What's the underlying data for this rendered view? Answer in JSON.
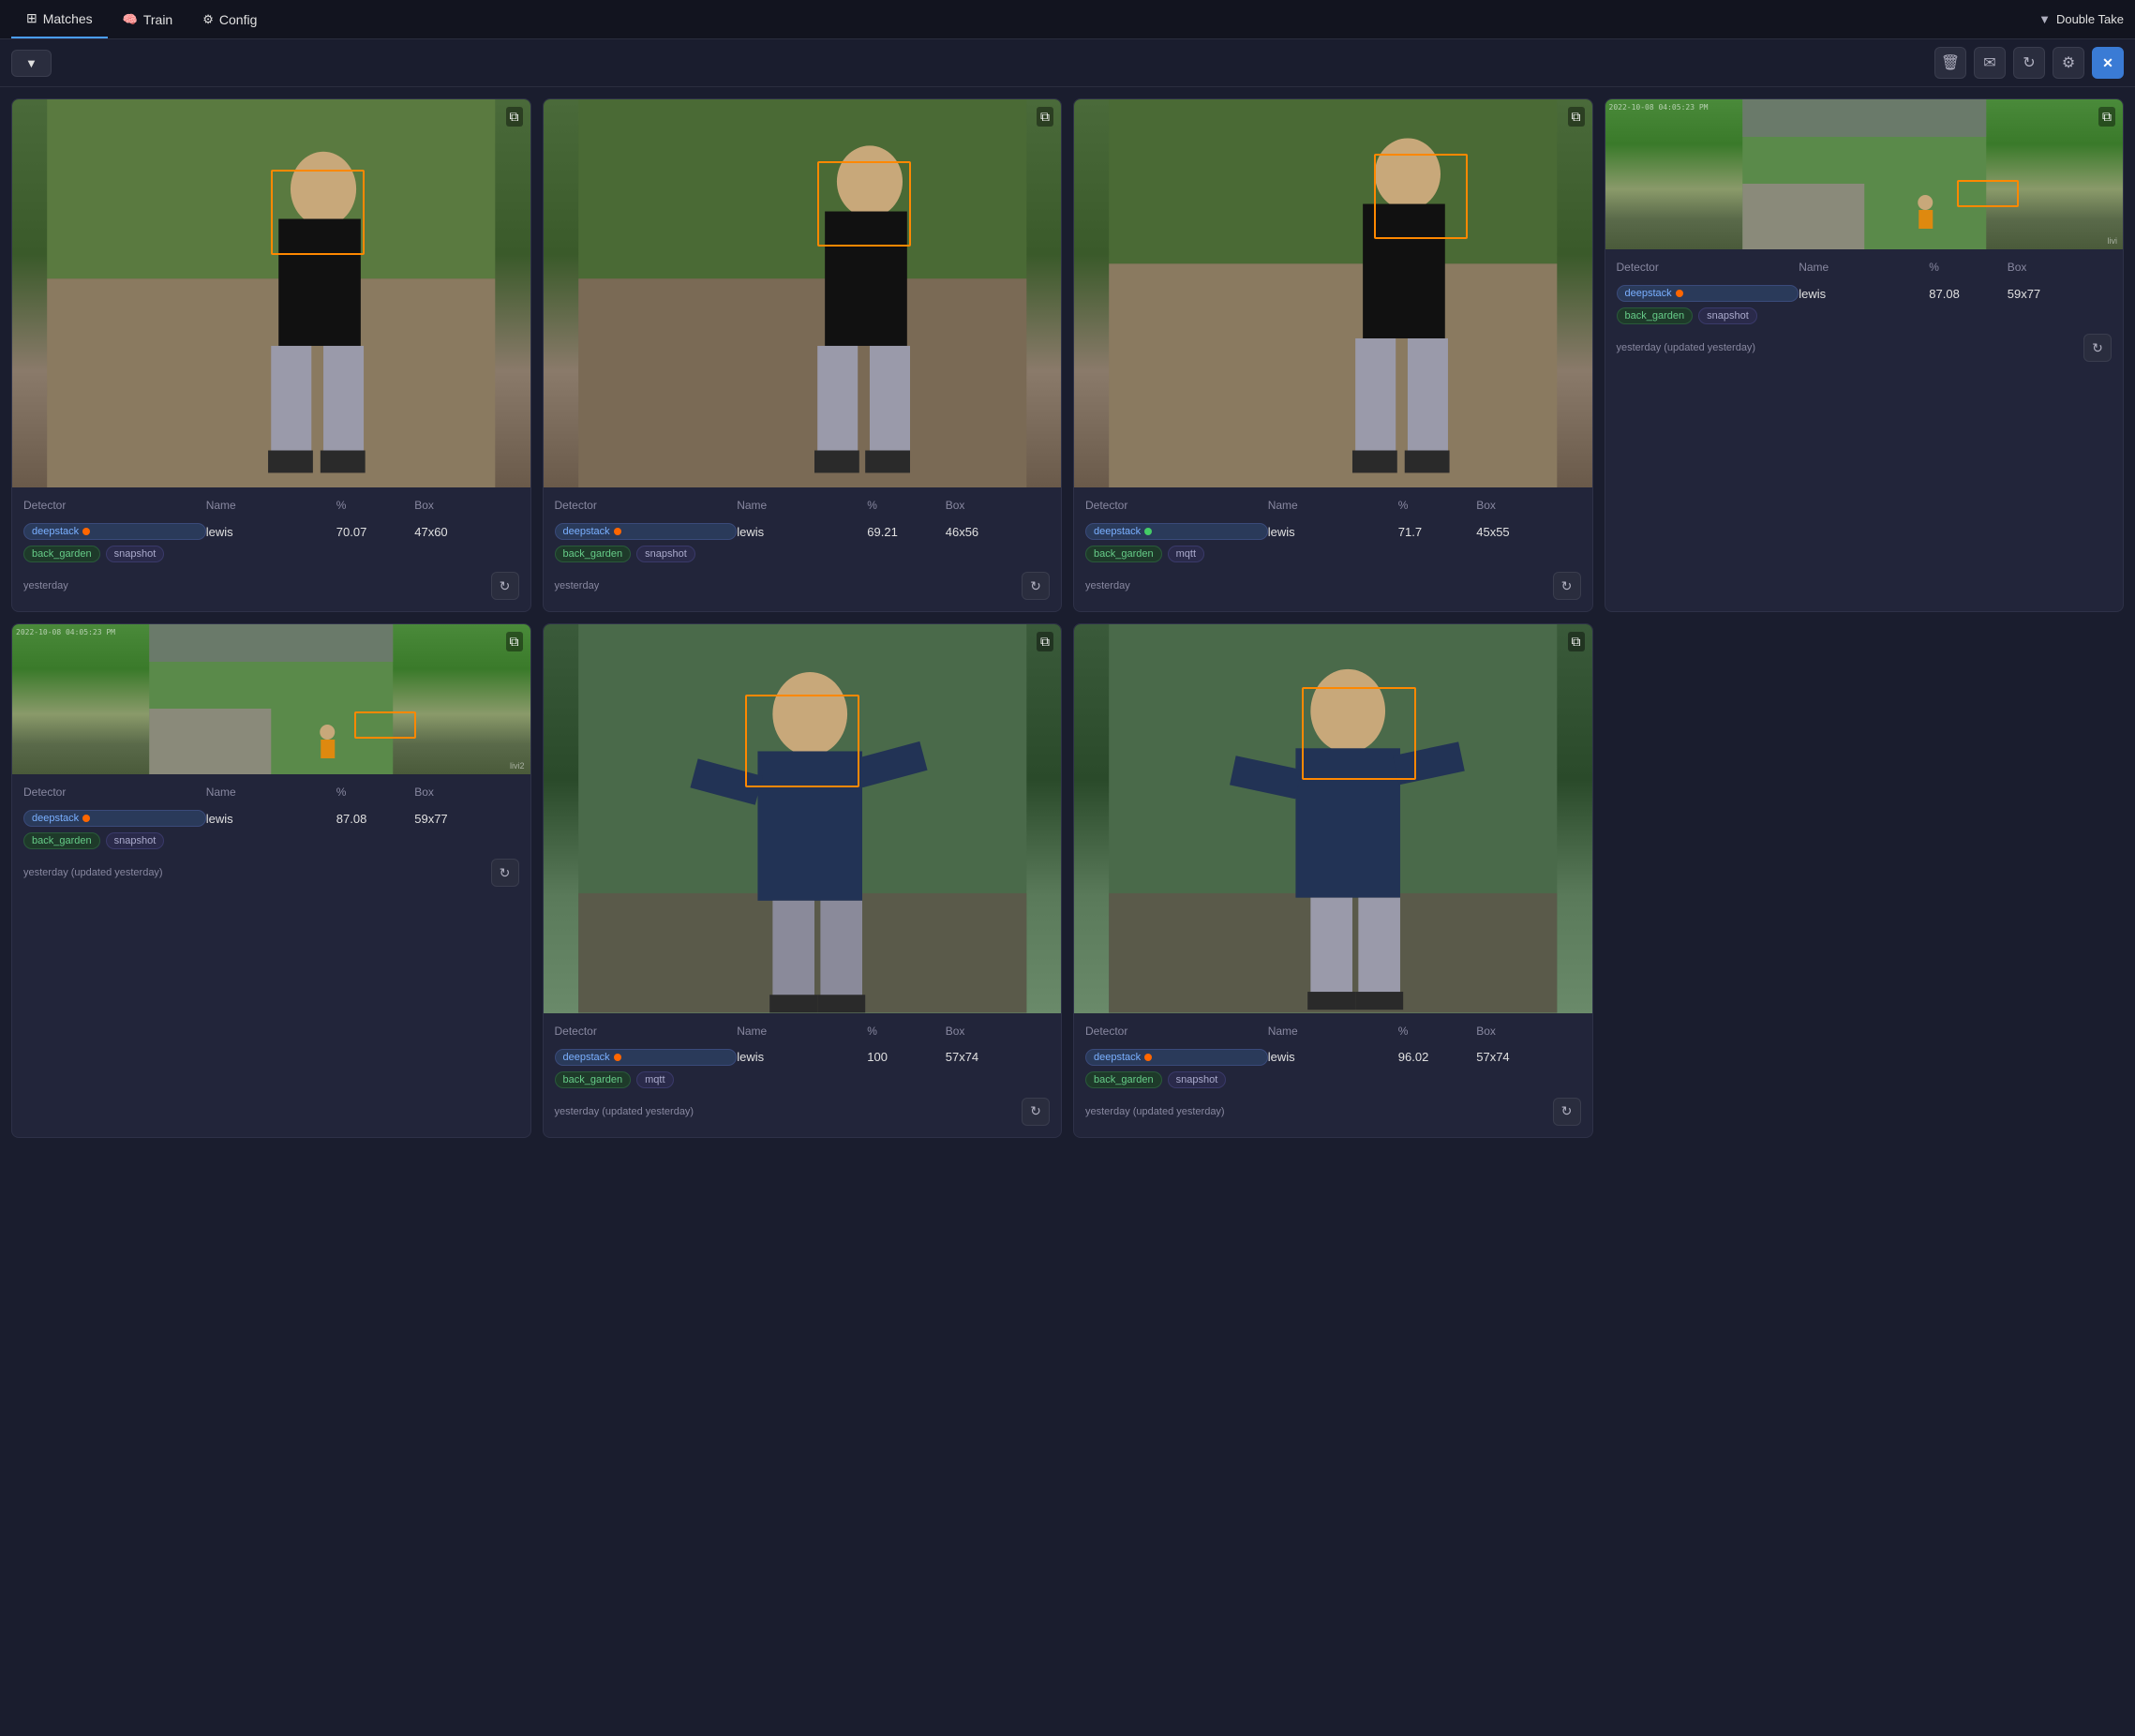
{
  "nav": {
    "tabs": [
      {
        "id": "matches",
        "label": "Matches",
        "active": true,
        "icon": "grid"
      },
      {
        "id": "train",
        "label": "Train",
        "active": false,
        "icon": "brain"
      },
      {
        "id": "config",
        "label": "Config",
        "active": false,
        "icon": "gear"
      }
    ],
    "app_title": "Double Take",
    "chevron": "▼"
  },
  "toolbar": {
    "filter_label": "▼",
    "icons": [
      "🗑",
      "✉",
      "↻",
      "⚙",
      "✕"
    ]
  },
  "cards": [
    {
      "id": "card1",
      "image_type": "person_standing",
      "detector": "deepstack",
      "detector_dot": "orange",
      "name": "lewis",
      "percent": "70.07",
      "box": "47x60",
      "location": "back_garden",
      "type": "snapshot",
      "time": "yesterday",
      "updated": "",
      "face_box": {
        "top": "18%",
        "left": "50%",
        "width": "20%",
        "height": "20%"
      }
    },
    {
      "id": "card2",
      "image_type": "person_standing",
      "detector": "deepstack",
      "detector_dot": "orange",
      "name": "lewis",
      "percent": "69.21",
      "box": "46x56",
      "location": "back_garden",
      "type": "snapshot",
      "time": "yesterday",
      "updated": "",
      "face_box": {
        "top": "16%",
        "left": "55%",
        "width": "18%",
        "height": "18%"
      }
    },
    {
      "id": "card3",
      "image_type": "person_standing",
      "detector": "deepstack",
      "detector_dot": "green",
      "name": "lewis",
      "percent": "71.7",
      "box": "45x55",
      "location": "back_garden",
      "type": "mqtt",
      "time": "yesterday",
      "updated": "",
      "face_box": {
        "top": "14%",
        "left": "60%",
        "width": "18%",
        "height": "18%"
      }
    },
    {
      "id": "card4",
      "image_type": "aerial",
      "detector": "deepstack",
      "detector_dot": "orange",
      "name": "lewis",
      "percent": "87.08",
      "box": "59x77",
      "location": "back_garden",
      "type": "snapshot",
      "time": "yesterday",
      "updated": "(updated yesterday)",
      "face_box": {
        "top": "55%",
        "left": "72%",
        "width": "12%",
        "height": "14%"
      }
    }
  ],
  "cards_row2": [
    {
      "id": "card5",
      "image_type": "aerial",
      "detector": "deepstack",
      "detector_dot": "orange",
      "name": "lewis",
      "percent": "87.08",
      "box": "59x77",
      "location": "back_garden",
      "type": "snapshot",
      "time": "yesterday",
      "updated": "(updated yesterday)",
      "face_box": {
        "top": "58%",
        "left": "68%",
        "width": "12%",
        "height": "14%"
      }
    },
    {
      "id": "card6",
      "image_type": "person_sweatshirt",
      "detector": "deepstack",
      "detector_dot": "orange",
      "name": "lewis",
      "percent": "100",
      "box": "57x74",
      "location": "back_garden",
      "type": "mqtt",
      "time": "yesterday",
      "updated": "(updated yesterday)",
      "face_box": {
        "top": "20%",
        "left": "42%",
        "width": "22%",
        "height": "22%"
      }
    },
    {
      "id": "card7",
      "image_type": "person_sweatshirt",
      "detector": "deepstack",
      "detector_dot": "orange",
      "name": "lewis",
      "percent": "96.02",
      "box": "57x74",
      "location": "back_garden",
      "type": "snapshot",
      "time": "yesterday",
      "updated": "(updated yesterday)",
      "face_box": {
        "top": "18%",
        "left": "48%",
        "width": "22%",
        "height": "22%"
      }
    }
  ],
  "labels": {
    "detector": "Detector",
    "name": "Name",
    "percent": "%",
    "box": "Box",
    "yesterday": "yesterday",
    "updated_yesterday": "(updated yesterday)"
  }
}
